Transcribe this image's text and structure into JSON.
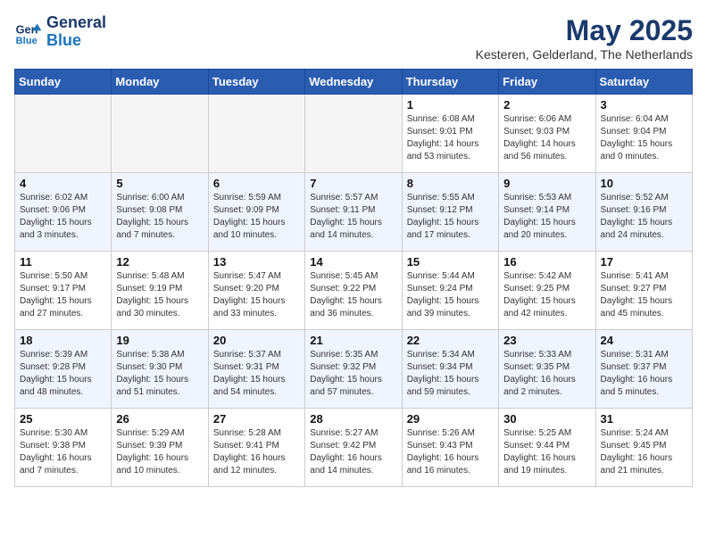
{
  "header": {
    "logo_line1": "General",
    "logo_line2": "Blue",
    "month": "May 2025",
    "location": "Kesteren, Gelderland, The Netherlands"
  },
  "days_of_week": [
    "Sunday",
    "Monday",
    "Tuesday",
    "Wednesday",
    "Thursday",
    "Friday",
    "Saturday"
  ],
  "weeks": [
    [
      {
        "day": "",
        "info": ""
      },
      {
        "day": "",
        "info": ""
      },
      {
        "day": "",
        "info": ""
      },
      {
        "day": "",
        "info": ""
      },
      {
        "day": "1",
        "info": "Sunrise: 6:08 AM\nSunset: 9:01 PM\nDaylight: 14 hours\nand 53 minutes."
      },
      {
        "day": "2",
        "info": "Sunrise: 6:06 AM\nSunset: 9:03 PM\nDaylight: 14 hours\nand 56 minutes."
      },
      {
        "day": "3",
        "info": "Sunrise: 6:04 AM\nSunset: 9:04 PM\nDaylight: 15 hours\nand 0 minutes."
      }
    ],
    [
      {
        "day": "4",
        "info": "Sunrise: 6:02 AM\nSunset: 9:06 PM\nDaylight: 15 hours\nand 3 minutes."
      },
      {
        "day": "5",
        "info": "Sunrise: 6:00 AM\nSunset: 9:08 PM\nDaylight: 15 hours\nand 7 minutes."
      },
      {
        "day": "6",
        "info": "Sunrise: 5:59 AM\nSunset: 9:09 PM\nDaylight: 15 hours\nand 10 minutes."
      },
      {
        "day": "7",
        "info": "Sunrise: 5:57 AM\nSunset: 9:11 PM\nDaylight: 15 hours\nand 14 minutes."
      },
      {
        "day": "8",
        "info": "Sunrise: 5:55 AM\nSunset: 9:12 PM\nDaylight: 15 hours\nand 17 minutes."
      },
      {
        "day": "9",
        "info": "Sunrise: 5:53 AM\nSunset: 9:14 PM\nDaylight: 15 hours\nand 20 minutes."
      },
      {
        "day": "10",
        "info": "Sunrise: 5:52 AM\nSunset: 9:16 PM\nDaylight: 15 hours\nand 24 minutes."
      }
    ],
    [
      {
        "day": "11",
        "info": "Sunrise: 5:50 AM\nSunset: 9:17 PM\nDaylight: 15 hours\nand 27 minutes."
      },
      {
        "day": "12",
        "info": "Sunrise: 5:48 AM\nSunset: 9:19 PM\nDaylight: 15 hours\nand 30 minutes."
      },
      {
        "day": "13",
        "info": "Sunrise: 5:47 AM\nSunset: 9:20 PM\nDaylight: 15 hours\nand 33 minutes."
      },
      {
        "day": "14",
        "info": "Sunrise: 5:45 AM\nSunset: 9:22 PM\nDaylight: 15 hours\nand 36 minutes."
      },
      {
        "day": "15",
        "info": "Sunrise: 5:44 AM\nSunset: 9:24 PM\nDaylight: 15 hours\nand 39 minutes."
      },
      {
        "day": "16",
        "info": "Sunrise: 5:42 AM\nSunset: 9:25 PM\nDaylight: 15 hours\nand 42 minutes."
      },
      {
        "day": "17",
        "info": "Sunrise: 5:41 AM\nSunset: 9:27 PM\nDaylight: 15 hours\nand 45 minutes."
      }
    ],
    [
      {
        "day": "18",
        "info": "Sunrise: 5:39 AM\nSunset: 9:28 PM\nDaylight: 15 hours\nand 48 minutes."
      },
      {
        "day": "19",
        "info": "Sunrise: 5:38 AM\nSunset: 9:30 PM\nDaylight: 15 hours\nand 51 minutes."
      },
      {
        "day": "20",
        "info": "Sunrise: 5:37 AM\nSunset: 9:31 PM\nDaylight: 15 hours\nand 54 minutes."
      },
      {
        "day": "21",
        "info": "Sunrise: 5:35 AM\nSunset: 9:32 PM\nDaylight: 15 hours\nand 57 minutes."
      },
      {
        "day": "22",
        "info": "Sunrise: 5:34 AM\nSunset: 9:34 PM\nDaylight: 15 hours\nand 59 minutes."
      },
      {
        "day": "23",
        "info": "Sunrise: 5:33 AM\nSunset: 9:35 PM\nDaylight: 16 hours\nand 2 minutes."
      },
      {
        "day": "24",
        "info": "Sunrise: 5:31 AM\nSunset: 9:37 PM\nDaylight: 16 hours\nand 5 minutes."
      }
    ],
    [
      {
        "day": "25",
        "info": "Sunrise: 5:30 AM\nSunset: 9:38 PM\nDaylight: 16 hours\nand 7 minutes."
      },
      {
        "day": "26",
        "info": "Sunrise: 5:29 AM\nSunset: 9:39 PM\nDaylight: 16 hours\nand 10 minutes."
      },
      {
        "day": "27",
        "info": "Sunrise: 5:28 AM\nSunset: 9:41 PM\nDaylight: 16 hours\nand 12 minutes."
      },
      {
        "day": "28",
        "info": "Sunrise: 5:27 AM\nSunset: 9:42 PM\nDaylight: 16 hours\nand 14 minutes."
      },
      {
        "day": "29",
        "info": "Sunrise: 5:26 AM\nSunset: 9:43 PM\nDaylight: 16 hours\nand 16 minutes."
      },
      {
        "day": "30",
        "info": "Sunrise: 5:25 AM\nSunset: 9:44 PM\nDaylight: 16 hours\nand 19 minutes."
      },
      {
        "day": "31",
        "info": "Sunrise: 5:24 AM\nSunset: 9:45 PM\nDaylight: 16 hours\nand 21 minutes."
      }
    ]
  ]
}
